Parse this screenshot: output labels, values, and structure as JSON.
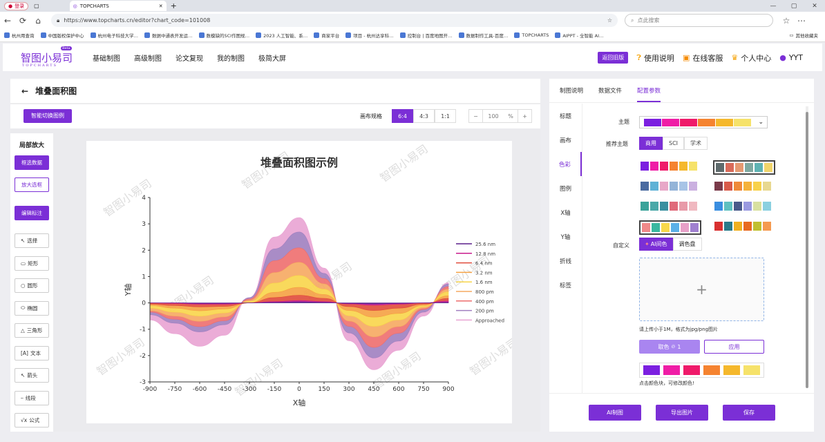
{
  "browser": {
    "profile": "登录",
    "tab_title": "TOPCHARTS",
    "url": "https://www.topcharts.cn/editor?chart_code=101008",
    "search_placeholder": "点此搜索",
    "bookmarks": [
      "杭州用查询",
      "中国版权保护中心",
      "杭州电子科技大学…",
      "数据中通表开发运…",
      "数模缺的SCI作图规…",
      "2023 人工智能、系…",
      "商家平台",
      "项目 - 杭州达享科…",
      "控制台 | 百度地图开…",
      "数据制作工具-百度…",
      "TOPCHARTS",
      "AIPPT - 全智能 AI…"
    ],
    "other_bookmarks": "其他收藏夹"
  },
  "app": {
    "logo": "智图小易司",
    "logo_sub": "TOPCHARTS",
    "beta": "Beta",
    "nav": [
      "基础制图",
      "高级制图",
      "论文复现",
      "我的制图",
      "极简大屏"
    ],
    "old_btn": "返回旧版",
    "help": "使用说明",
    "service": "在线客服",
    "personal": "个人中心",
    "user": "YYT"
  },
  "editor": {
    "title": "堆叠面积图",
    "smart_btn": "智能切换图例",
    "ratio_label": "画布规格",
    "ratios": [
      "6:4",
      "4:3",
      "1:1"
    ],
    "zoom": "100",
    "zoom_unit": "%",
    "minus": "−",
    "plus": "+"
  },
  "tools": {
    "title": "局部放大",
    "frame_data": "框选数据",
    "zoom_box": "放大选框",
    "edit_label": "编辑标注",
    "items": [
      "选择",
      "矩形",
      "圆形",
      "椭圆",
      "三角形",
      "文本",
      "箭头",
      "线段",
      "公式"
    ]
  },
  "chart_data": {
    "type": "area",
    "title": "堆叠面积图示例",
    "xlabel": "X轴",
    "ylabel": "Y轴",
    "xlim": [
      -900,
      900
    ],
    "ylim": [
      -3,
      4
    ],
    "xticks": [
      "-900",
      "-750",
      "-600",
      "-450",
      "-300",
      "-150",
      "0",
      "150",
      "300",
      "450",
      "600",
      "750",
      "900"
    ],
    "yticks": [
      "-3",
      "-2",
      "-1",
      "0",
      "1",
      "2",
      "3",
      "4"
    ],
    "legend_position": "right",
    "x": [
      -900,
      -750,
      -600,
      -450,
      -300,
      -150,
      0,
      150,
      300,
      450,
      600,
      750,
      900
    ],
    "series": [
      {
        "name": "25.6 nm",
        "color": "#5a1e8c",
        "values": [
          0,
          0,
          -0.02,
          -0.02,
          0,
          0.02,
          0.04,
          0.02,
          -0.02,
          -0.04,
          -0.02,
          0,
          0.02
        ]
      },
      {
        "name": "12.8 nm",
        "color": "#c81a8c",
        "values": [
          0,
          -0.02,
          -0.03,
          -0.03,
          0,
          0.03,
          0.05,
          0.03,
          -0.02,
          -0.05,
          -0.03,
          0,
          0.05
        ]
      },
      {
        "name": "6.4 nm",
        "color": "#e04a3a",
        "values": [
          -0.05,
          -0.08,
          -0.1,
          -0.08,
          0,
          0.15,
          0.2,
          0.12,
          -0.1,
          -0.2,
          -0.15,
          -0.05,
          0.1
        ]
      },
      {
        "name": "3.2 nm",
        "color": "#f5a142",
        "values": [
          -0.05,
          -0.1,
          -0.15,
          -0.1,
          0,
          0.2,
          0.3,
          0.15,
          -0.15,
          -0.25,
          -0.2,
          -0.05,
          0.1
        ]
      },
      {
        "name": "1.6 nm",
        "color": "#f8d54a",
        "values": [
          -0.1,
          -0.15,
          -0.2,
          -0.15,
          0.05,
          0.35,
          0.45,
          0.2,
          -0.2,
          -0.35,
          -0.25,
          -0.05,
          0.15
        ]
      },
      {
        "name": "800 pm",
        "color": "#f6a860",
        "values": [
          -0.1,
          -0.15,
          -0.2,
          -0.15,
          0.05,
          0.4,
          0.5,
          0.2,
          -0.2,
          -0.4,
          -0.25,
          -0.05,
          0.1
        ]
      },
      {
        "name": "400 pm",
        "color": "#ee6e6e",
        "values": [
          -0.05,
          -0.12,
          -0.2,
          -0.15,
          0.05,
          0.45,
          0.55,
          0.2,
          -0.2,
          -0.4,
          -0.25,
          -0.05,
          0.1
        ]
      },
      {
        "name": "200 pm",
        "color": "#a07fc0",
        "values": [
          -0.1,
          -0.15,
          -0.2,
          -0.15,
          0.05,
          0.45,
          0.6,
          0.2,
          -0.25,
          -0.4,
          -0.3,
          -0.1,
          0.1
        ]
      },
      {
        "name": "Approached",
        "color": "#e9a3d3",
        "values": [
          -0.2,
          -0.4,
          -0.55,
          -0.4,
          0,
          0.45,
          0.55,
          0.2,
          -0.3,
          -0.45,
          -0.35,
          -0.15,
          0.05
        ]
      }
    ],
    "watermark": "智图小易司"
  },
  "panel": {
    "tabs": [
      "制图说明",
      "数据文件",
      "配置参数"
    ],
    "side": [
      "标题",
      "画布",
      "色彩",
      "图例",
      "X轴",
      "Y轴",
      "折线",
      "标签"
    ],
    "theme_label": "主题",
    "theme_colors": [
      "#7b1fe0",
      "#ef1da6",
      "#ef1a6a",
      "#f58330",
      "#f5b82c",
      "#f6e26a"
    ],
    "rec_label": "推荐主题",
    "rec_tabs": [
      "商用",
      "SCI",
      "学术"
    ],
    "palettes": [
      [
        "#7b1fe0",
        "#ef1da6",
        "#ef1a6a",
        "#f58330",
        "#f5b82c",
        "#f6e26a"
      ],
      [
        "#5f6b6d",
        "#d96b5a",
        "#e59a72",
        "#7fa9a1",
        "#5fb3b3",
        "#f1d56b"
      ],
      [
        "#4a6aa0",
        "#5fb2d6",
        "#e8a8c8",
        "#94b4d8",
        "#a8c4e6",
        "#cbb0e0"
      ],
      [
        "#7a3a4a",
        "#d85a4a",
        "#ef8a3a",
        "#f5b23a",
        "#f8d24a",
        "#e8d890"
      ],
      [
        "#3aa39a",
        "#4aa8a8",
        "#3a90a0",
        "#e06a7a",
        "#e89aa8",
        "#f0b8c0"
      ],
      [
        "#3a8ee0",
        "#5fc0c0",
        "#4a5a8a",
        "#9a9ae0",
        "#d8e0a0",
        "#8ad0e0"
      ],
      [
        "#f08a8a",
        "#3ab8a0",
        "#f8d84a",
        "#5ab0e8",
        "#e8a0c8",
        "#a080d0"
      ],
      [
        "#d83030",
        "#2a7a8a",
        "#f0b020",
        "#e86a20",
        "#c0c030",
        "#f59a50"
      ]
    ],
    "custom_label": "自定义",
    "custom_tabs": [
      "AI间色",
      "调色盘"
    ],
    "upload_plus": "+",
    "upload_hint": "请上传小于1M，格式为jpg/png图片",
    "pick_btn": "取色",
    "pick_count": "1",
    "apply_btn": "应用",
    "custom_colors": [
      "#7b1fe0",
      "#ef1da6",
      "#ef1a6a",
      "#f58330",
      "#f5b82c",
      "#f6e26a"
    ],
    "color_hint": "点击颜色块，可修改颜色!",
    "ai_btn": "AI制图",
    "export_btn": "导出图片",
    "save_btn": "保存"
  }
}
